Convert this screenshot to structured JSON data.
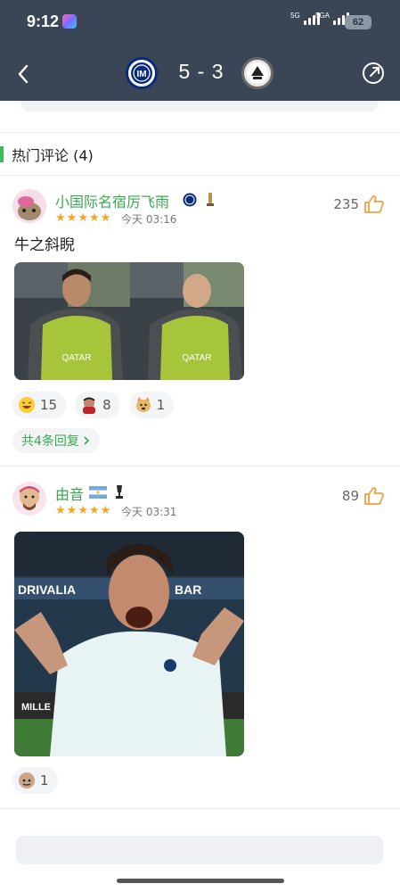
{
  "status_bar": {
    "time": "9:12",
    "signal1_label": "5G",
    "signal2_label": "5GA",
    "battery": "62"
  },
  "match": {
    "score": "5 - 3",
    "home_team_icon": "inter-milan-logo",
    "away_team_icon": "udinese-logo"
  },
  "comments_section": {
    "title": "热门评论 (4)"
  },
  "comments": [
    {
      "username": "小国际名宿厉飞雨",
      "stars": 5,
      "time": "今天 03:16",
      "likes": "235",
      "text": "牛之斜睨",
      "reactions": [
        {
          "icon": "laugh-emoji",
          "count": "15"
        },
        {
          "icon": "red-devil-emoji",
          "count": "8"
        },
        {
          "icon": "doge-emoji",
          "count": "1"
        }
      ],
      "replies_label": "共4条回复"
    },
    {
      "username": "由音",
      "stars": 5,
      "time": "今天 03:31",
      "likes": "89",
      "reactions": [
        {
          "icon": "bald-face-emoji",
          "count": "1"
        }
      ]
    }
  ],
  "colors": {
    "header_bg": "#3a4656",
    "accent_green": "#3aa852",
    "star": "#f5a623",
    "like_icon": "#f0a040"
  }
}
